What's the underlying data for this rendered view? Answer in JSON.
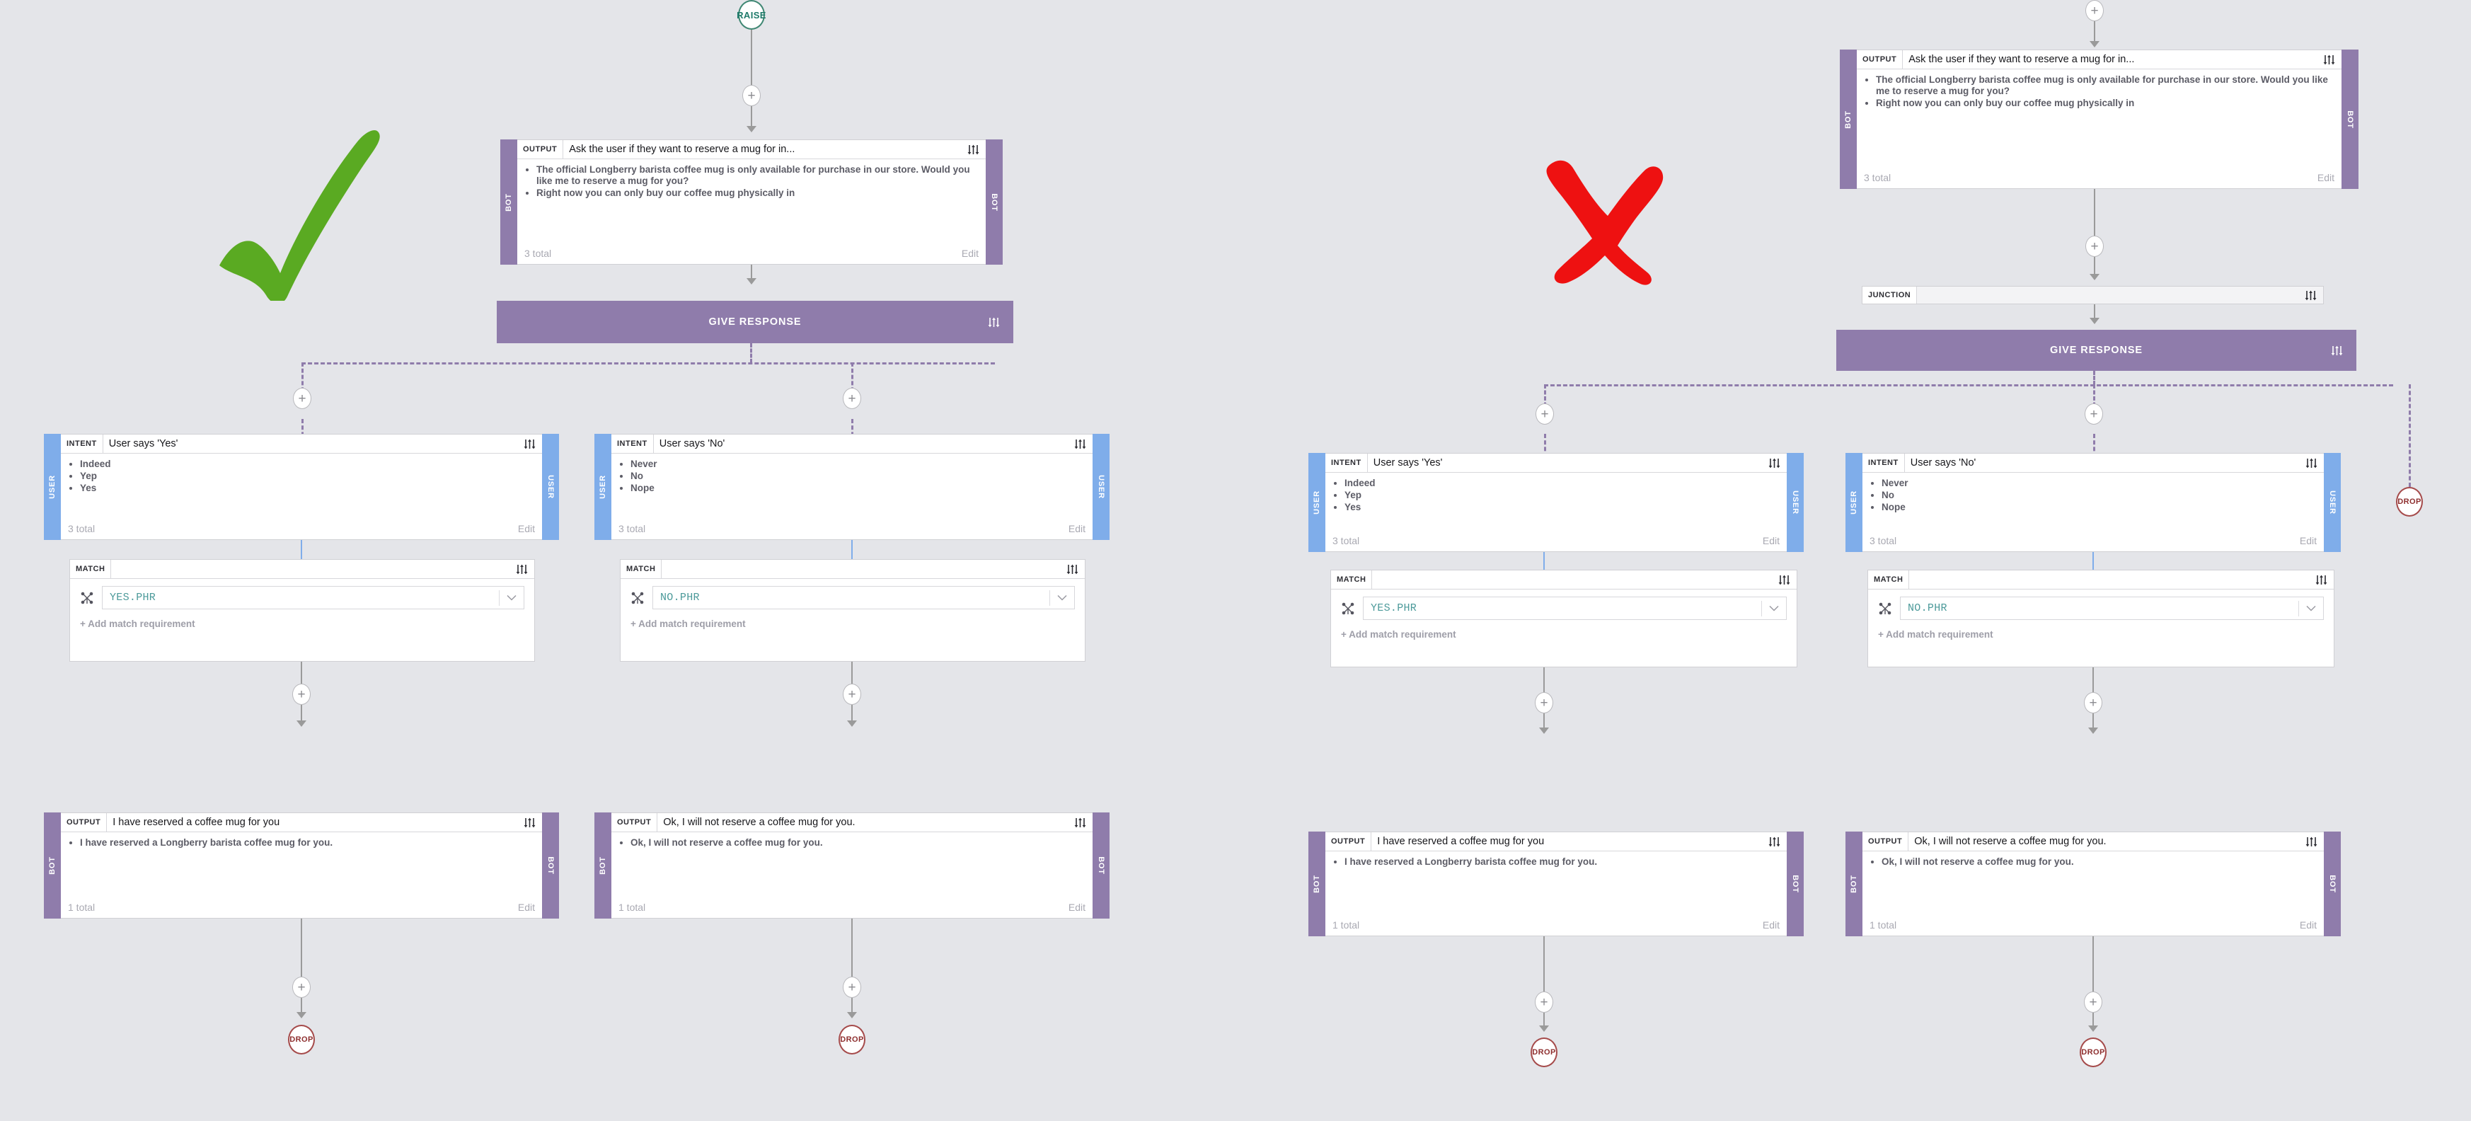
{
  "colors": {
    "canvas_bg": "#e4e5e9",
    "bot_purple": "#8f7cab",
    "user_blue": "#7fadea",
    "raise_green": "#1f7a6a",
    "drop_red": "#8e2f2f",
    "check_green": "#5aaa22",
    "cross_red": "#ee1111",
    "value_teal": "#4c9a9a"
  },
  "labels": {
    "tag_output": "OUTPUT",
    "tag_intent": "INTENT",
    "tag_match": "MATCH",
    "tag_junction": "JUNCTION",
    "rail_bot": "BOT",
    "rail_user": "USER",
    "give_response": "GIVE RESPONSE",
    "raise": "RAISE",
    "drop": "DROP",
    "edit": "Edit",
    "add_match_requirement": "+ Add match requirement",
    "total_3": "3 total",
    "total_1": "1 total"
  },
  "annotations": {
    "good": "check-mark",
    "bad": "cross-mark"
  },
  "nodes": {
    "ask_output": {
      "tag": "OUTPUT",
      "title": "Ask the user if they want to reserve a mug for in...",
      "items": [
        "The official Longberry barista coffee mug is only available for purchase in our store. Would you like me to reserve a mug for you?",
        "Right now you can only buy our coffee mug physically in"
      ],
      "count": "3 total",
      "edit": "Edit",
      "rail": "BOT"
    },
    "intent_yes": {
      "tag": "INTENT",
      "title": "User says 'Yes'",
      "items": [
        "Indeed",
        "Yep",
        "Yes"
      ],
      "count": "3 total",
      "edit": "Edit",
      "rail": "USER"
    },
    "intent_no": {
      "tag": "INTENT",
      "title": "User says 'No'",
      "items": [
        "Never",
        "No",
        "Nope"
      ],
      "count": "3 total",
      "edit": "Edit",
      "rail": "USER"
    },
    "match_yes": {
      "tag": "MATCH",
      "value": "YES.PHR",
      "add": "+ Add match requirement"
    },
    "match_no": {
      "tag": "MATCH",
      "value": "NO.PHR",
      "add": "+ Add match requirement"
    },
    "output_reserved": {
      "tag": "OUTPUT",
      "title": "I have reserved a coffee mug for you",
      "items": [
        "I have reserved a Longberry barista coffee mug for you."
      ],
      "count": "1 total",
      "edit": "Edit",
      "rail": "BOT"
    },
    "output_not_reserved": {
      "tag": "OUTPUT",
      "title": "Ok, I will not reserve a coffee mug for you.",
      "items": [
        "Ok, I will not reserve a coffee mug for you."
      ],
      "count": "1 total",
      "edit": "Edit",
      "rail": "BOT"
    },
    "junction": {
      "tag": "JUNCTION",
      "title": ""
    }
  }
}
